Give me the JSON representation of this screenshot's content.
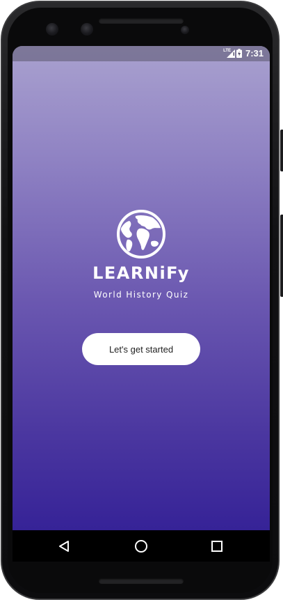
{
  "status_bar": {
    "network": "LTE",
    "time": "7:31",
    "icons": [
      "signal-icon",
      "battery-icon"
    ]
  },
  "splash": {
    "logo_icon": "globe-icon",
    "app_name": "LEARNiFy",
    "tagline": "World History Quiz",
    "start_button_label": "Let's get started"
  },
  "nav_bar": {
    "icons": [
      "back-icon",
      "home-icon",
      "recents-icon"
    ]
  },
  "colors": {
    "gradient_top": "#a9a1cf",
    "gradient_bottom": "#2f1c94",
    "button_bg": "#ffffff",
    "text_light": "#ffffff"
  }
}
